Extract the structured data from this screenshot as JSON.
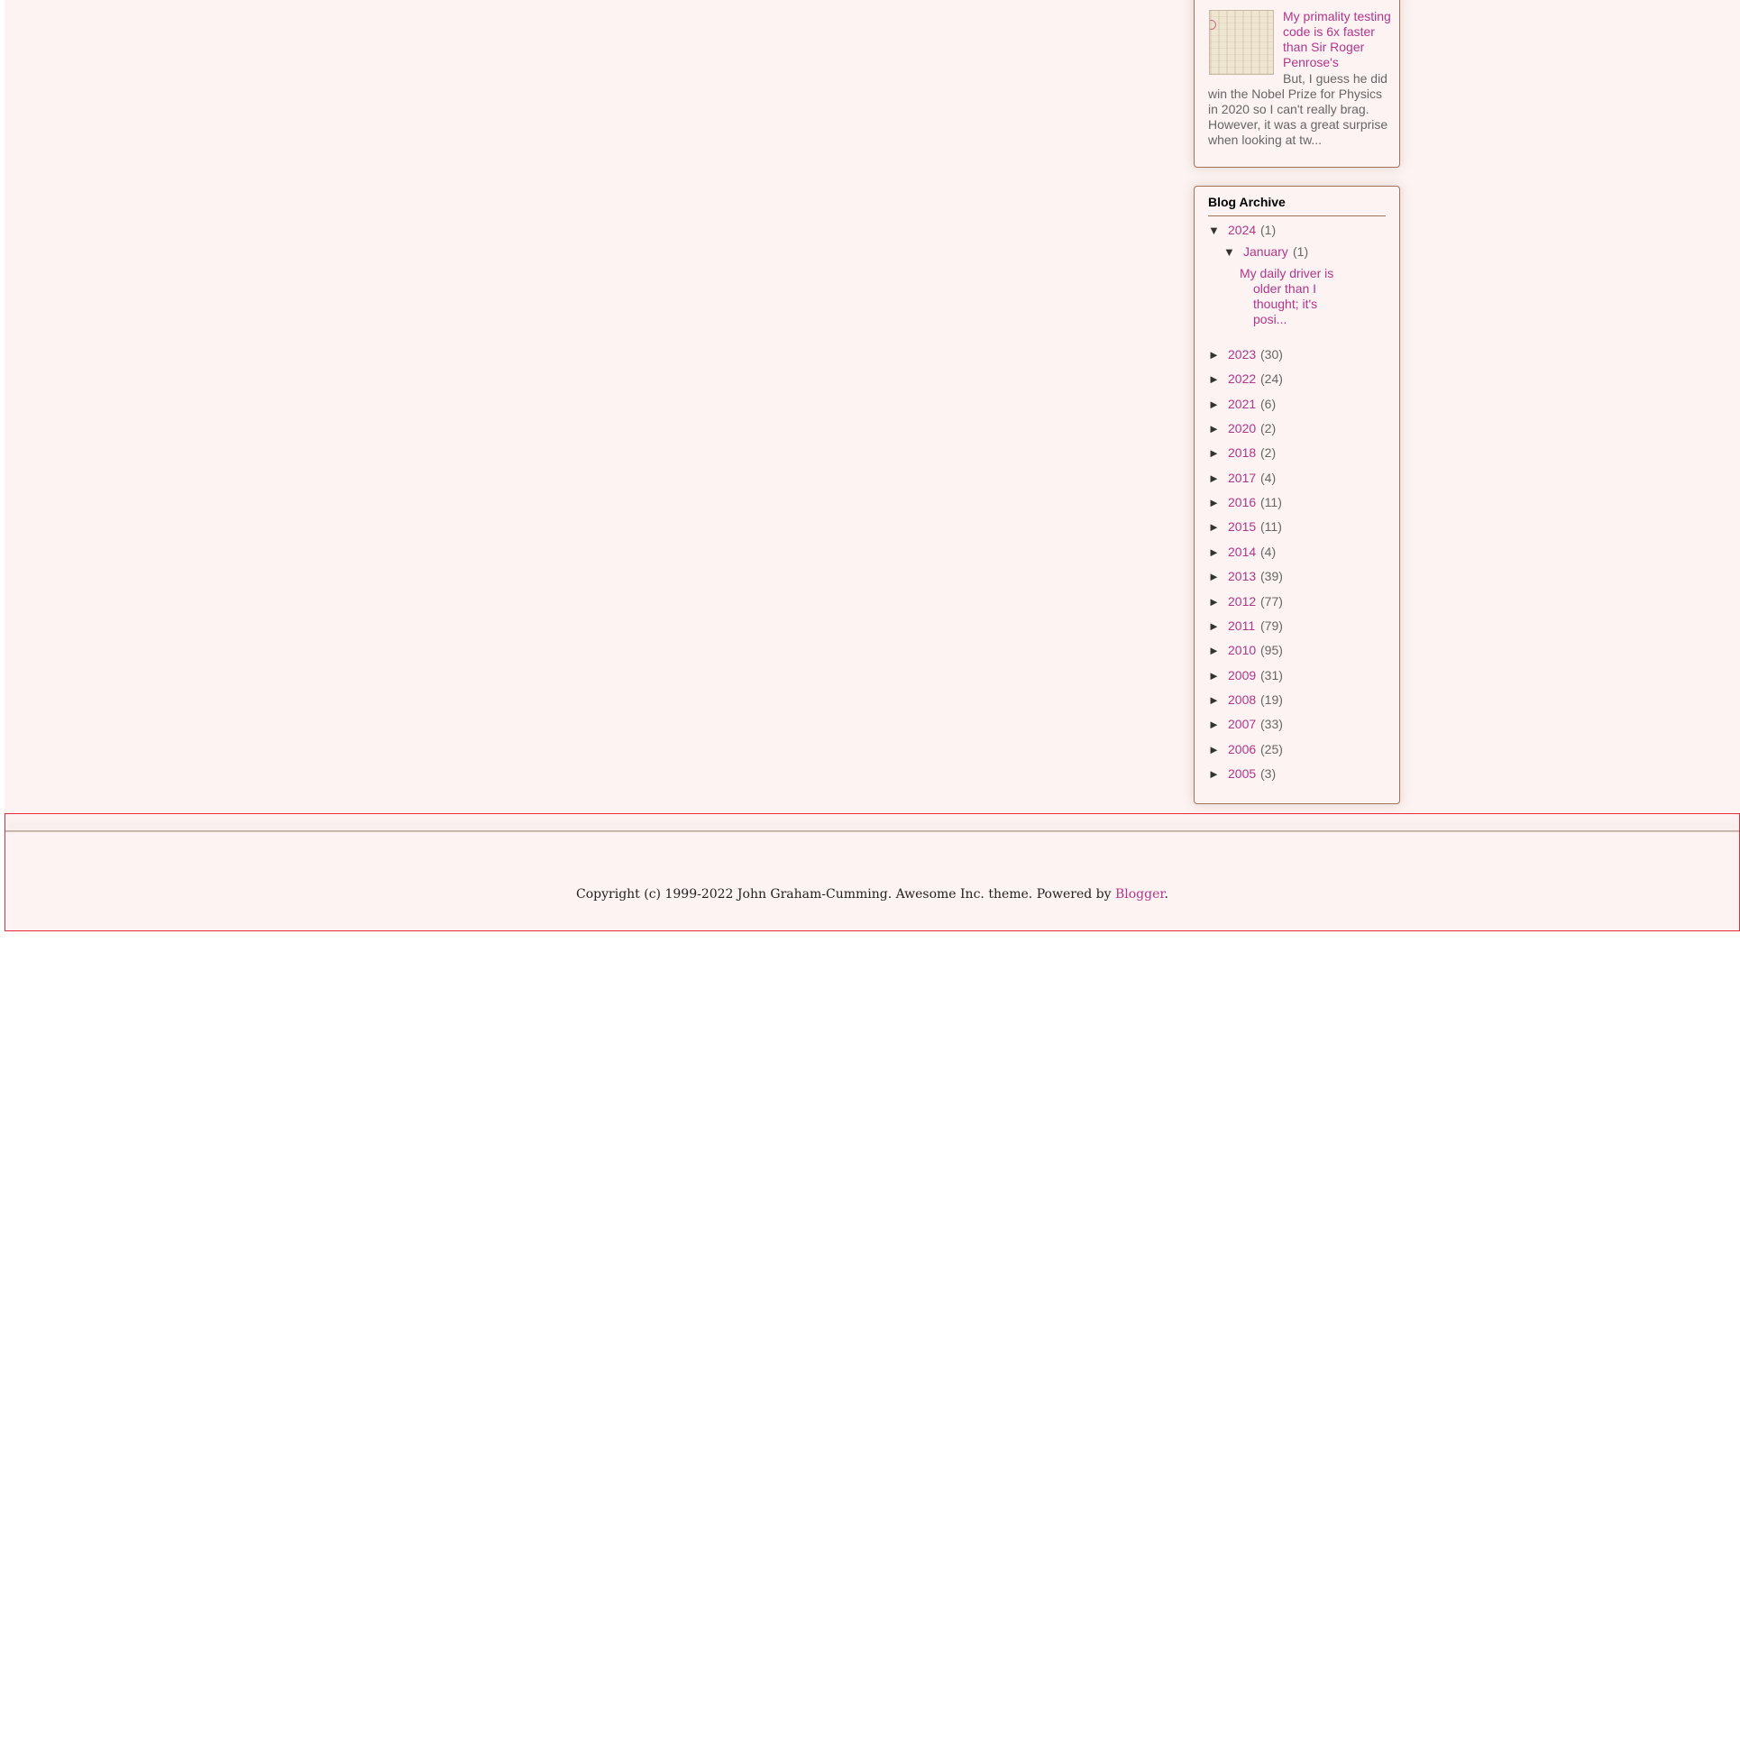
{
  "colors": {
    "page_background": "#fcf3f2",
    "link": "#b0368c",
    "text": "#666666",
    "border": "#a0725a",
    "footer_border": "#e62a3c"
  },
  "popular_post": {
    "title": "My primality testing code is 6x faster than Sir Roger Penrose's",
    "snippet": "But, I guess he did win the Nobel Prize for Physics in 2020 so I can't really brag. However, it was a great surprise when looking at tw..."
  },
  "blog_archive": {
    "title": "Blog Archive",
    "expanded_icon": "▼",
    "collapsed_icon": "►",
    "open_year": {
      "year": "2024",
      "count": "(1)",
      "month": {
        "name": "January",
        "count": "(1)",
        "post": "My daily driver is older than I thought; it's posi..."
      }
    },
    "years": [
      {
        "year": "2023",
        "count": "(30)"
      },
      {
        "year": "2022",
        "count": "(24)"
      },
      {
        "year": "2021",
        "count": "(6)"
      },
      {
        "year": "2020",
        "count": "(2)"
      },
      {
        "year": "2018",
        "count": "(2)"
      },
      {
        "year": "2017",
        "count": "(4)"
      },
      {
        "year": "2016",
        "count": "(11)"
      },
      {
        "year": "2015",
        "count": "(11)"
      },
      {
        "year": "2014",
        "count": "(4)"
      },
      {
        "year": "2013",
        "count": "(39)"
      },
      {
        "year": "2012",
        "count": "(77)"
      },
      {
        "year": "2011",
        "count": "(79)"
      },
      {
        "year": "2010",
        "count": "(95)"
      },
      {
        "year": "2009",
        "count": "(31)"
      },
      {
        "year": "2008",
        "count": "(19)"
      },
      {
        "year": "2007",
        "count": "(33)"
      },
      {
        "year": "2006",
        "count": "(25)"
      },
      {
        "year": "2005",
        "count": "(3)"
      }
    ]
  },
  "footer": {
    "text": "Copyright (c) 1999-2022 John Graham-Cumming. Awesome Inc. theme. Powered by ",
    "link_label": "Blogger",
    "suffix": "."
  }
}
